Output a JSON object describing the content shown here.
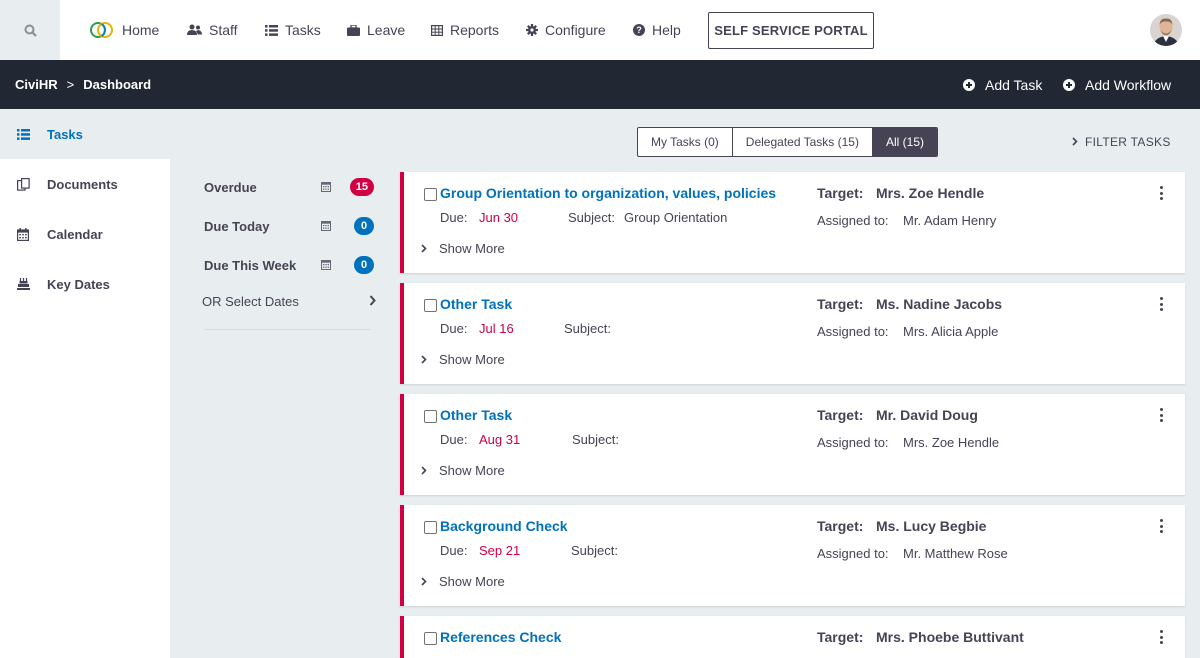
{
  "topnav": {
    "items": [
      {
        "label": "Home"
      },
      {
        "label": "Staff"
      },
      {
        "label": "Tasks"
      },
      {
        "label": "Leave"
      },
      {
        "label": "Reports"
      },
      {
        "label": "Configure"
      },
      {
        "label": "Help"
      }
    ],
    "portal_button": "SELF SERVICE PORTAL"
  },
  "breadcrumb": {
    "root": "CiviHR",
    "separator": ">",
    "current": "Dashboard"
  },
  "actions": {
    "add_task": "Add Task",
    "add_workflow": "Add Workflow"
  },
  "sidebar": {
    "items": [
      {
        "label": "Tasks",
        "icon": "list-icon",
        "active": true
      },
      {
        "label": "Documents",
        "icon": "documents-icon"
      },
      {
        "label": "Calendar",
        "icon": "calendar-icon"
      },
      {
        "label": "Key Dates",
        "icon": "key-dates-icon"
      }
    ]
  },
  "filters": {
    "overdue": {
      "label": "Overdue",
      "count": "15"
    },
    "due_today": {
      "label": "Due Today",
      "count": "0"
    },
    "due_week": {
      "label": "Due This Week",
      "count": "0"
    },
    "or_select": "OR Select Dates"
  },
  "tabs": [
    {
      "label": "My Tasks (0)"
    },
    {
      "label": "Delegated Tasks (15)"
    },
    {
      "label": "All (15)",
      "active": true
    }
  ],
  "filter_tasks_label": "FILTER TASKS",
  "labels": {
    "due": "Due:",
    "subject": "Subject:",
    "target": "Target:",
    "assigned": "Assigned to:",
    "show_more": "Show More"
  },
  "tasks": [
    {
      "title": "Group Orientation to organization, values, policies",
      "due": "Jun 30",
      "subject": "Group Orientation",
      "target": "Mrs. Zoe Hendle",
      "assigned": "Mr. Adam Henry"
    },
    {
      "title": "Other Task",
      "due": "Jul 16",
      "subject": "",
      "target": "Ms. Nadine Jacobs",
      "assigned": "Mrs. Alicia Apple"
    },
    {
      "title": "Other Task",
      "due": "Aug 31",
      "subject": "",
      "target": "Mr. David Doug",
      "assigned": "Mrs. Zoe Hendle"
    },
    {
      "title": "Background Check",
      "due": "Sep 21",
      "subject": "",
      "target": "Ms. Lucy Begbie",
      "assigned": "Mr. Matthew Rose"
    },
    {
      "title": "References Check",
      "due": "",
      "subject": "",
      "target": "Mrs. Phoebe Buttivant",
      "assigned": ""
    }
  ],
  "colors": {
    "accent": "#0071bd",
    "overdue": "#d00043",
    "dark_bar": "#222734",
    "text": "#464354"
  }
}
